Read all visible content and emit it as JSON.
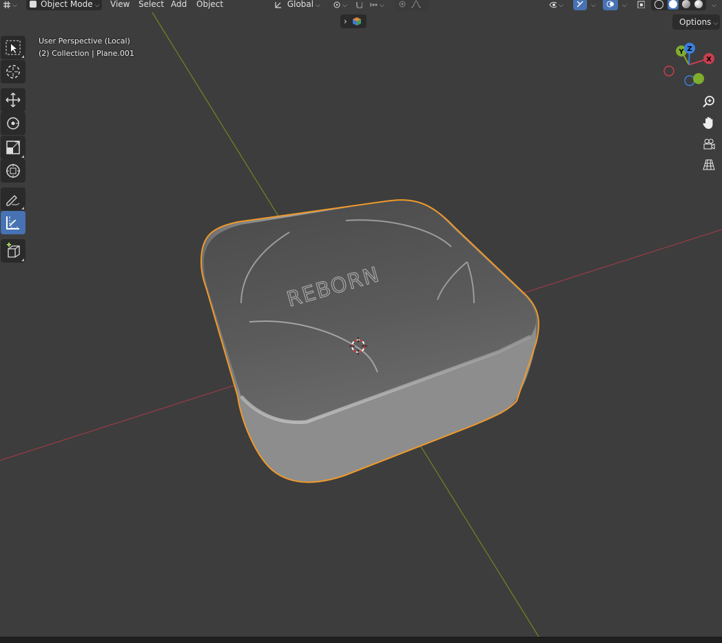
{
  "header": {
    "mode_label": "Object Mode",
    "menus": [
      "View",
      "Select",
      "Add",
      "Object"
    ],
    "orientation_label": "Global",
    "options_label": "Options"
  },
  "overlay": {
    "view_name": "User Perspective (Local)",
    "collection_info": "(2) Collection | Plane.001"
  },
  "gizmo": {
    "x_label": "X",
    "y_label": "Y",
    "z_label": "Z"
  },
  "model": {
    "engraved_text": "REBORN"
  },
  "toolbar": {
    "tools": [
      "select-box",
      "cursor",
      "move",
      "rotate",
      "scale",
      "transform",
      "annotate",
      "measure",
      "add-cube"
    ],
    "active_tool": "measure"
  },
  "colors": {
    "background": "#3d3d3d",
    "x_axis": "#9b3a47",
    "y_axis": "#6d8a1e",
    "selection_outline": "#f09a2a",
    "active_tool": "#4772b3"
  }
}
